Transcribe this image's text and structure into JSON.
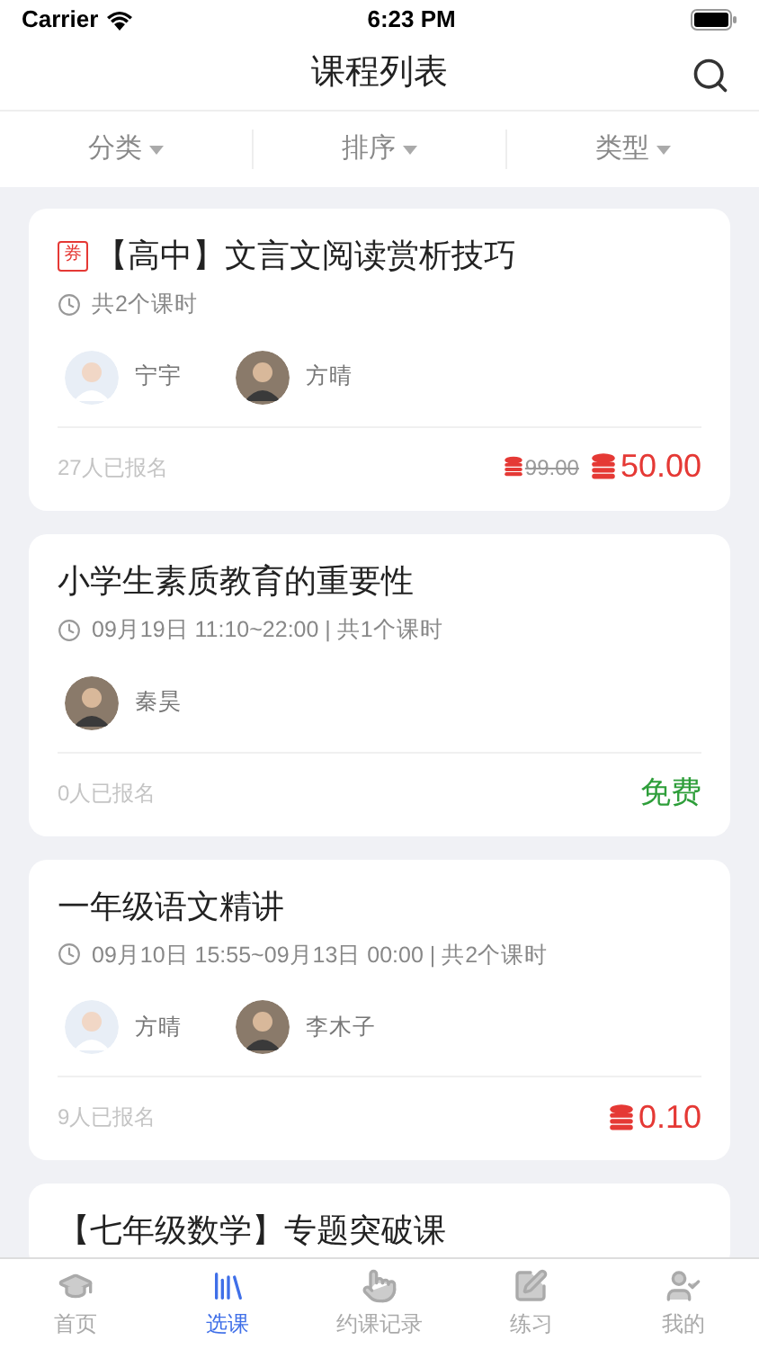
{
  "status_bar": {
    "carrier": "Carrier",
    "time": "6:23 PM"
  },
  "nav": {
    "title": "课程列表"
  },
  "filters": [
    {
      "label": "分类"
    },
    {
      "label": "排序"
    },
    {
      "label": "类型"
    }
  ],
  "courses": [
    {
      "badge": "券",
      "title": "【高中】文言文阅读赏析技巧",
      "meta": "共2个课时",
      "teachers": [
        {
          "name": "宁宇"
        },
        {
          "name": "方晴"
        }
      ],
      "enrolled": "27人已报名",
      "price": {
        "kind": "paid",
        "original": "99.00",
        "current": "50.00"
      }
    },
    {
      "title": "小学生素质教育的重要性",
      "meta": "09月19日 11:10~22:00 | 共1个课时",
      "teachers": [
        {
          "name": "秦昊"
        }
      ],
      "enrolled": "0人已报名",
      "price": {
        "kind": "free",
        "current": "免费"
      }
    },
    {
      "title": "一年级语文精讲",
      "meta": "09月10日 15:55~09月13日 00:00 | 共2个课时",
      "teachers": [
        {
          "name": "方晴"
        },
        {
          "name": "李木子"
        }
      ],
      "enrolled": "9人已报名",
      "price": {
        "kind": "paid",
        "current": "0.10"
      }
    },
    {
      "title": "【七年级数学】专题突破课"
    }
  ],
  "tab_bar": [
    {
      "label": "首页",
      "selected": false
    },
    {
      "label": "选课",
      "selected": true
    },
    {
      "label": "约课记录",
      "selected": false
    },
    {
      "label": "练习",
      "selected": false
    },
    {
      "label": "我的",
      "selected": false
    }
  ]
}
